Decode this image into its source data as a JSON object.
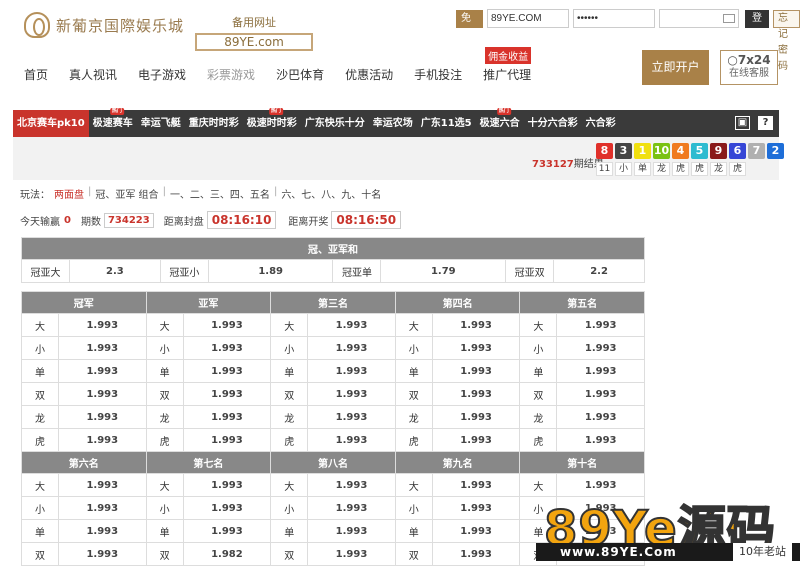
{
  "header": {
    "logo_text": "新葡京国際娱乐城",
    "backup_label": "备用网址",
    "backup_url": "89YE.com",
    "trial_button": "免费试玩",
    "username_value": "89YE.COM",
    "password_value": "••••••",
    "login_button": "登录",
    "forgot_button": "忘记密码",
    "open_account": "开户立即",
    "service_top": "7x24",
    "service_bottom": "在线客服"
  },
  "nav": {
    "items": [
      "首页",
      "真人视讯",
      "电子游戏",
      "彩票游戏",
      "沙巴体育",
      "优惠活动",
      "手机投注",
      "推广代理"
    ],
    "active_index": 3,
    "badge": "佣金收益"
  },
  "games": {
    "tabs": [
      "北京赛车pk10",
      "极速赛车",
      "幸运飞艇",
      "重庆时时彩",
      "极速时时彩",
      "广东快乐十分",
      "幸运农场",
      "广东11选5",
      "极速六合",
      "十分六合彩",
      "六合彩"
    ],
    "active_index": 0,
    "hot_label": "热门"
  },
  "results": {
    "period_number": "733127",
    "period_suffix": "期结果",
    "balls": [
      {
        "n": "8",
        "color": "#e0302a"
      },
      {
        "n": "3",
        "color": "#444444"
      },
      {
        "n": "1",
        "color": "#f0e010"
      },
      {
        "n": "10",
        "color": "#7ac213"
      },
      {
        "n": "4",
        "color": "#f07b20"
      },
      {
        "n": "5",
        "color": "#2dbbd0"
      },
      {
        "n": "9",
        "color": "#8a1a1a"
      },
      {
        "n": "6",
        "color": "#3646d6"
      },
      {
        "n": "7",
        "color": "#b0b0b0"
      },
      {
        "n": "2",
        "color": "#1e6ed8"
      }
    ],
    "stats": [
      "11",
      "小",
      "单",
      "龙",
      "虎",
      "虎",
      "龙",
      "虎"
    ]
  },
  "play": {
    "label": "玩法：",
    "options": [
      "两面盘",
      "冠、亚军 组合",
      "一、二、三、四、五名",
      "六、七、八、九、十名"
    ],
    "active_index": 0
  },
  "info": {
    "today_label": "今天输赢",
    "today_value": "0",
    "period_label": "期数",
    "period_value": "734223",
    "close_label": "距离封盘",
    "close_time": "08:16:10",
    "open_label": "距离开奖",
    "open_time": "08:16:50"
  },
  "sum_table": {
    "title": "冠、亚军和",
    "cells": [
      {
        "label": "冠亚大",
        "odds": "2.3"
      },
      {
        "label": "冠亚小",
        "odds": "1.89"
      },
      {
        "label": "冠亚单",
        "odds": "1.79"
      },
      {
        "label": "冠亚双",
        "odds": "2.2"
      }
    ]
  },
  "rank_tables": [
    {
      "headers": [
        "冠军",
        "亚军",
        "第三名",
        "第四名",
        "第五名"
      ],
      "rows": [
        {
          "label": "大",
          "odds": [
            "1.993",
            "1.993",
            "1.993",
            "1.993",
            "1.993"
          ]
        },
        {
          "label": "小",
          "odds": [
            "1.993",
            "1.993",
            "1.993",
            "1.993",
            "1.993"
          ]
        },
        {
          "label": "单",
          "odds": [
            "1.993",
            "1.993",
            "1.993",
            "1.993",
            "1.993"
          ]
        },
        {
          "label": "双",
          "odds": [
            "1.993",
            "1.993",
            "1.993",
            "1.993",
            "1.993"
          ]
        },
        {
          "label": "龙",
          "odds": [
            "1.993",
            "1.993",
            "1.993",
            "1.993",
            "1.993"
          ]
        },
        {
          "label": "虎",
          "odds": [
            "1.993",
            "1.993",
            "1.993",
            "1.993",
            "1.993"
          ]
        }
      ]
    },
    {
      "headers": [
        "第六名",
        "第七名",
        "第八名",
        "第九名",
        "第十名"
      ],
      "rows": [
        {
          "label": "大",
          "odds": [
            "1.993",
            "1.993",
            "1.993",
            "1.993",
            "1.993"
          ]
        },
        {
          "label": "小",
          "odds": [
            "1.993",
            "1.993",
            "1.993",
            "1.993",
            "1.993"
          ]
        },
        {
          "label": "单",
          "odds": [
            "1.993",
            "1.993",
            "1.993",
            "1.993",
            "1.993"
          ]
        },
        {
          "label": "双",
          "odds": [
            "1.993",
            "1.982",
            "1.993",
            "1.993",
            "1.993"
          ]
        }
      ]
    }
  ],
  "watermark": {
    "big": "89Ye源码",
    "url": "www.89YE.Com",
    "tag": "10年老站"
  }
}
